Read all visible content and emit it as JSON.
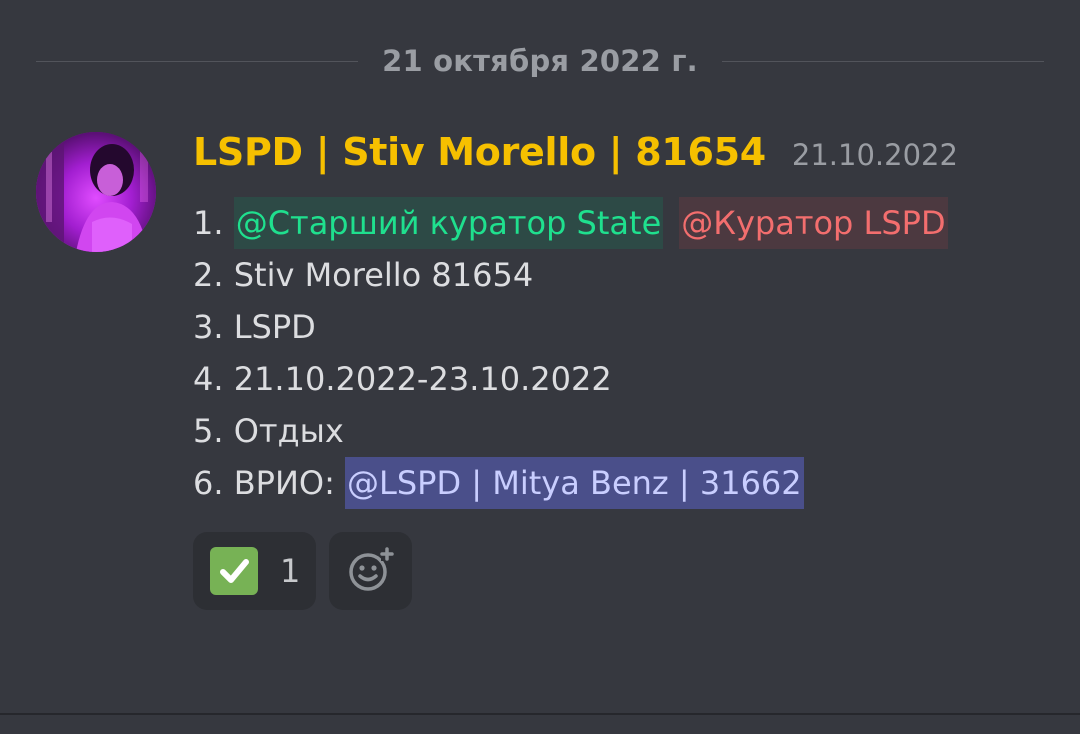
{
  "date_divider": "21 октября 2022 г.",
  "message": {
    "username": "LSPD | Stiv Morello | 81654",
    "timestamp": "21.10.2022",
    "lines": {
      "l1_prefix": "1. ",
      "l1_mention_1": "@Старший куратор State",
      "l1_mention_2": "@Куратор LSPD",
      "l2": "2. Stiv Morello 81654",
      "l3": "3. LSPD",
      "l4": "4. 21.10.2022-23.10.2022",
      "l5": "5. Отдых",
      "l6_prefix": "6. ВРИО: ",
      "l6_mention": "@LSPD | Mitya Benz | 31662"
    },
    "reactions": [
      {
        "emoji": "check-mark-icon",
        "count": "1"
      }
    ],
    "add_reaction_icon": "add-reaction-icon"
  },
  "colors": {
    "background": "#36383f",
    "username": "#f6c000",
    "mention_green": "#1fe08e",
    "mention_red": "#f36e6e",
    "mention_blue": "#c9ceff",
    "reaction_check": "#77b255"
  }
}
